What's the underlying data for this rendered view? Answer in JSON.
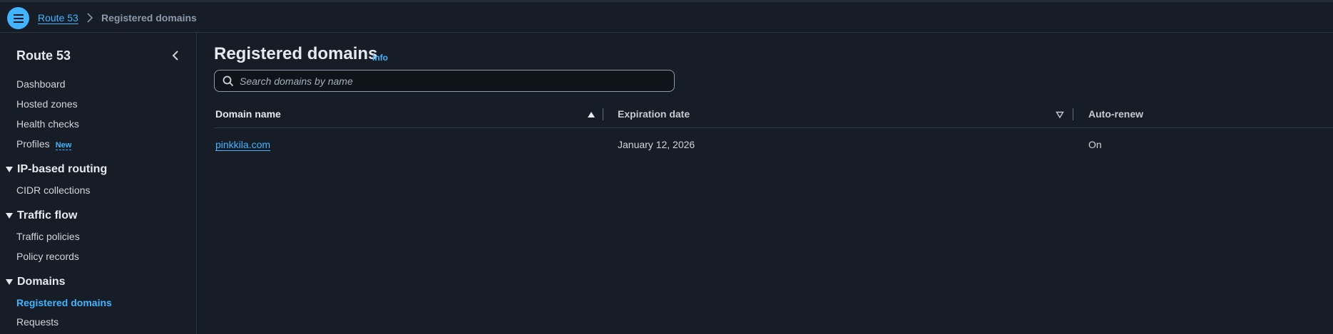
{
  "breadcrumb": {
    "root": "Route 53",
    "current": "Registered domains"
  },
  "sidebar": {
    "title": "Route 53",
    "items": [
      {
        "label": "Dashboard"
      },
      {
        "label": "Hosted zones"
      },
      {
        "label": "Health checks"
      },
      {
        "label": "Profiles",
        "badge": "New"
      }
    ],
    "sections": [
      {
        "label": "IP-based routing",
        "items": [
          {
            "label": "CIDR collections"
          }
        ]
      },
      {
        "label": "Traffic flow",
        "items": [
          {
            "label": "Traffic policies"
          },
          {
            "label": "Policy records"
          }
        ]
      },
      {
        "label": "Domains",
        "items": [
          {
            "label": "Registered domains",
            "active": true
          },
          {
            "label": "Requests"
          }
        ]
      }
    ]
  },
  "main": {
    "title": "Registered domains",
    "info": "Info",
    "search": {
      "placeholder": "Search domains by name",
      "value": ""
    },
    "table": {
      "columns": [
        "Domain name",
        "Expiration date",
        "Auto-renew"
      ],
      "rows": [
        {
          "domain": "pinkkila.com",
          "expiration": "January 12, 2026",
          "auto_renew": "On"
        }
      ]
    }
  },
  "colors": {
    "accent": "#42b4ff",
    "background": "#161d26",
    "border": "#2e3744"
  },
  "icons": [
    "hamburger-menu-icon",
    "chevron-right-icon",
    "chevron-left-icon",
    "caret-down-icon",
    "search-icon",
    "sort-ascending-icon",
    "sort-descending-icon"
  ]
}
